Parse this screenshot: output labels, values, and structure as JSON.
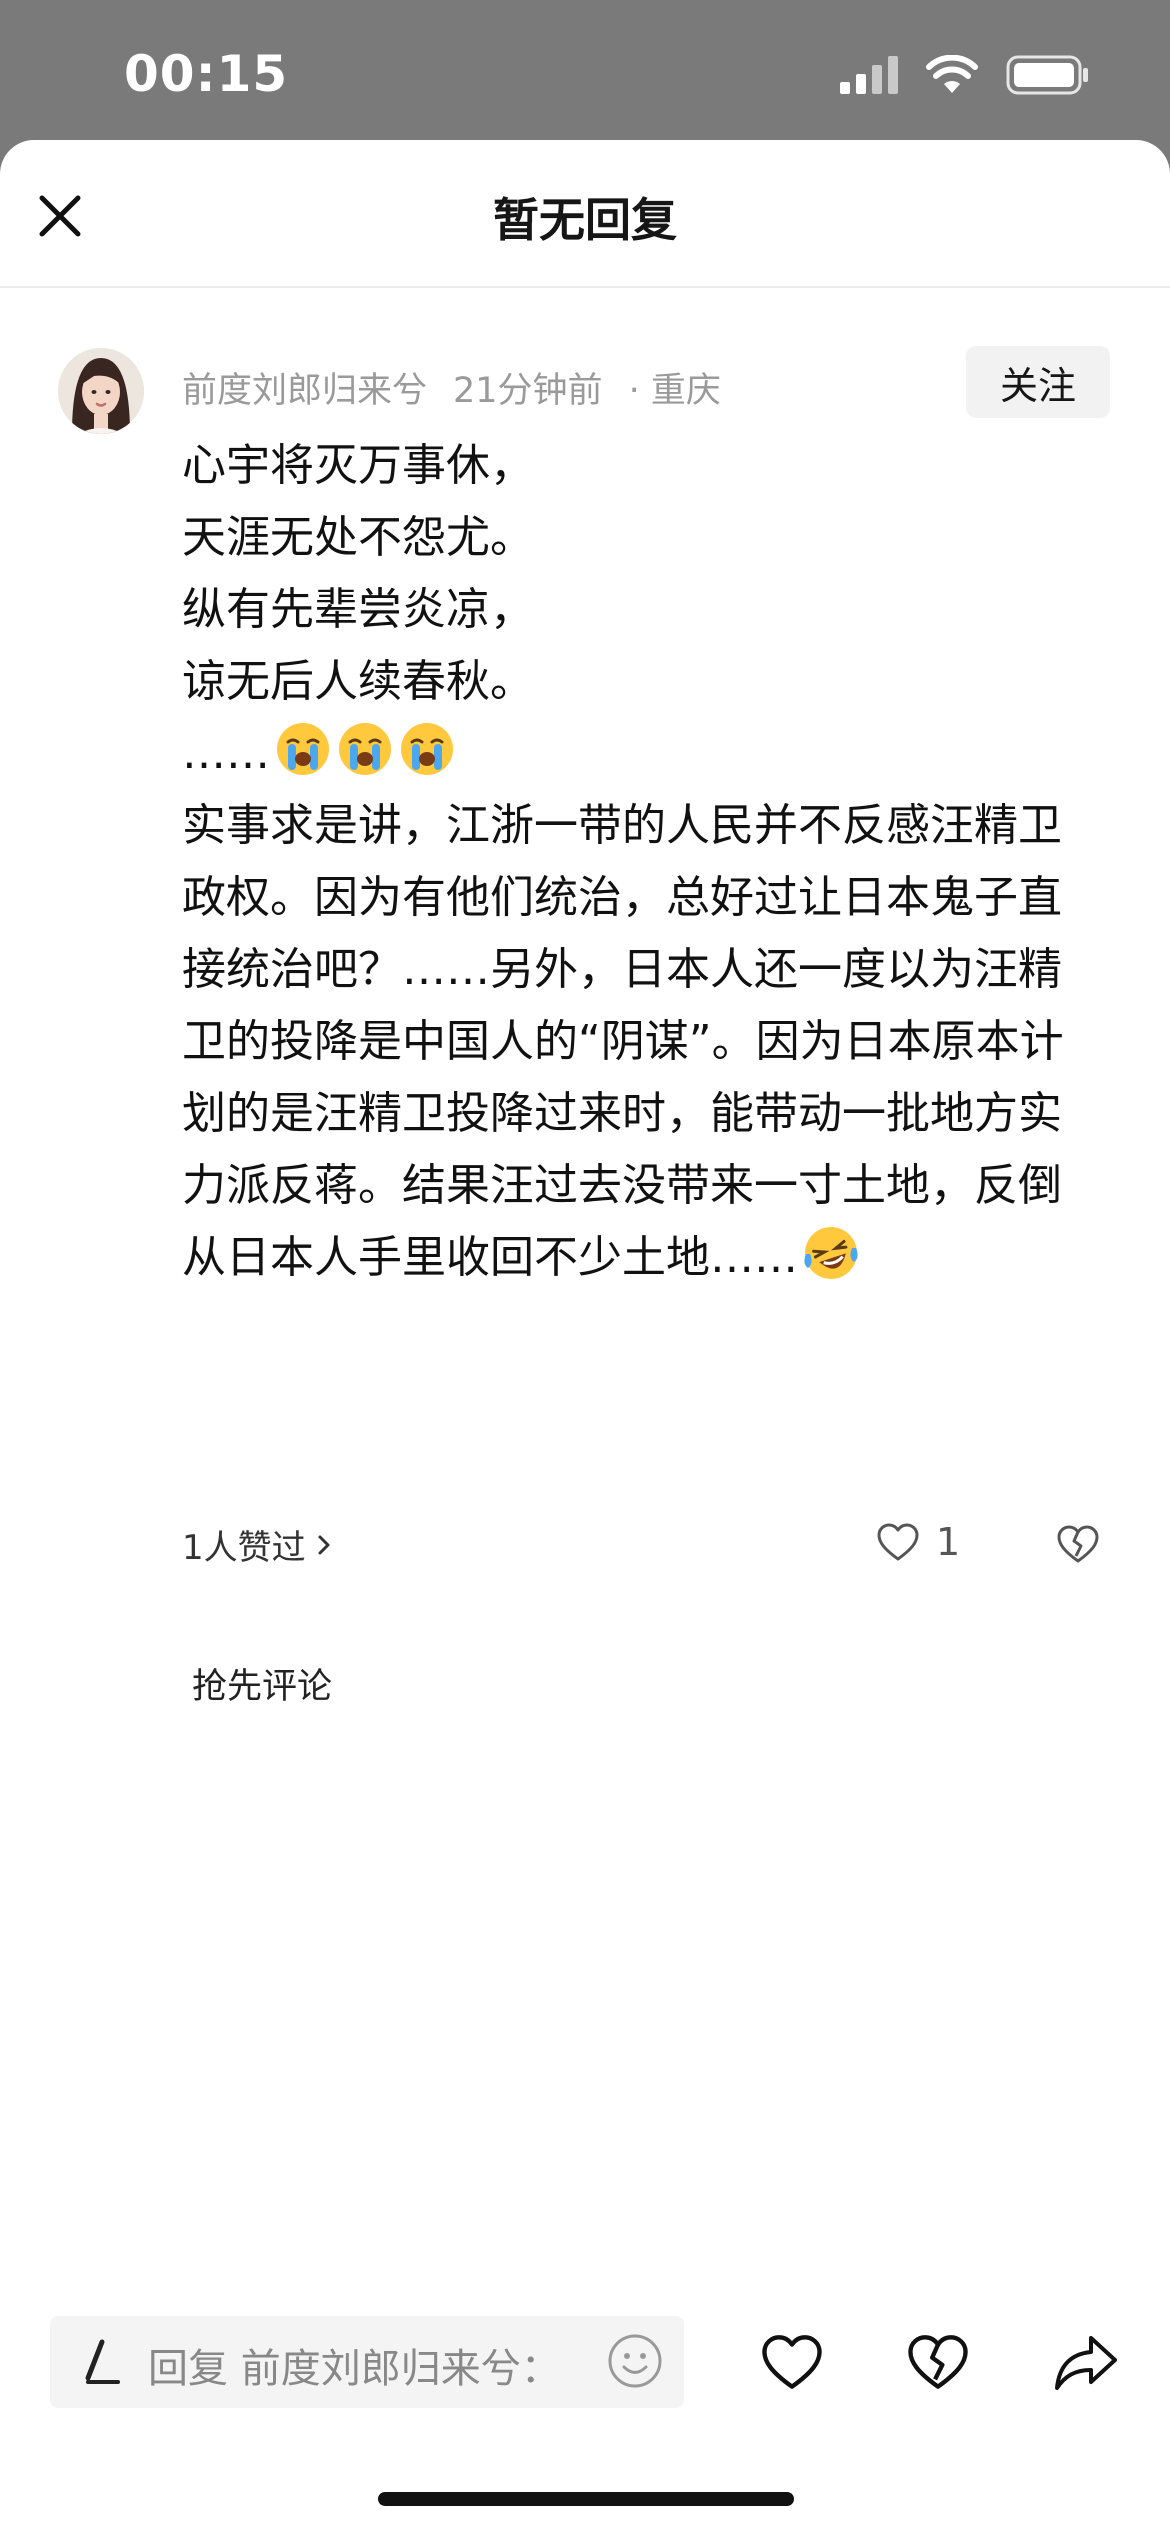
{
  "status_bar": {
    "time": "00:15"
  },
  "sheet": {
    "title": "暂无回复"
  },
  "comment": {
    "author": "前度刘郎归来兮",
    "time_ago": "21分钟前",
    "location": "· 重庆",
    "follow_label": "关注",
    "lines": [
      "心宇将灭万事休，",
      "天涯无处不怨尤。",
      "纵有先辈尝炎凉，",
      "谅无后人续春秋。",
      "……"
    ],
    "paragraph": "实事求是讲，江浙一带的人民并不反感汪精卫政权。因为有他们统治，总好过让日本鬼子直接统治吧？……另外，日本人还一度以为汪精卫的投降是中国人的“阴谋”。因为日本原本计划的是汪精卫投降过来时，能带动一批地方实力派反蒋。结果汪过去没带来一寸土地，反倒从日本人手里收回不少土地……",
    "emoji_after_ellipsis": "crying-face-emoji",
    "emoji_at_end": "laughing-crying-emoji",
    "likers_label": "1人赞过",
    "like_count": "1"
  },
  "first_comment_label": "抢先评论",
  "reply_bar": {
    "placeholder": "回复 前度刘郎归来兮："
  },
  "icons": {
    "close": "close-icon",
    "like": "heart-icon",
    "dislike": "broken-heart-icon",
    "share": "share-arrow-icon",
    "emoji": "smiley-icon",
    "pen": "pen-icon"
  },
  "colors": {
    "status_bar_bg": "#7a7a7a",
    "meta_text": "#9a9a9a",
    "follow_bg": "#f2f2f2",
    "reply_bg": "#f4f4f4"
  }
}
